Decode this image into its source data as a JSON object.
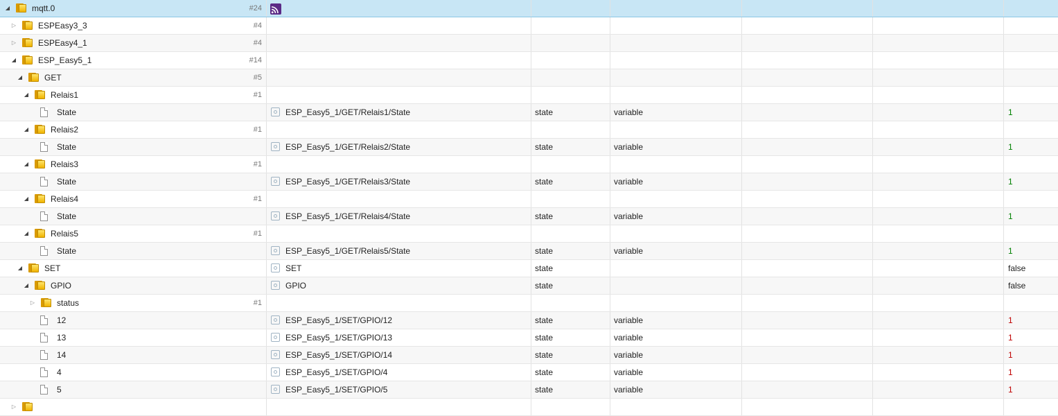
{
  "rows": [
    {
      "kind": "folder",
      "level": 0,
      "toggle": "expanded",
      "name": "mqtt.0",
      "count": "#24",
      "id": "",
      "type": "",
      "role": "",
      "value": "",
      "selected": true,
      "logo": "mqtt-adapter-icon"
    },
    {
      "kind": "folder",
      "level": 1,
      "toggle": "collapsed",
      "name": "ESPEasy3_3",
      "count": "#4",
      "id": "",
      "type": "",
      "role": "",
      "value": ""
    },
    {
      "kind": "folder",
      "level": 1,
      "toggle": "collapsed",
      "name": "ESPEasy4_1",
      "count": "#4",
      "id": "",
      "type": "",
      "role": "",
      "value": ""
    },
    {
      "kind": "folder",
      "level": 1,
      "toggle": "expanded",
      "name": "ESP_Easy5_1",
      "count": "#14",
      "id": "",
      "type": "",
      "role": "",
      "value": ""
    },
    {
      "kind": "folder",
      "level": 2,
      "toggle": "expanded",
      "name": "GET",
      "count": "#5",
      "id": "",
      "type": "",
      "role": "",
      "value": ""
    },
    {
      "kind": "folder",
      "level": 3,
      "toggle": "expanded",
      "name": "Relais1",
      "count": "#1",
      "id": "",
      "type": "",
      "role": "",
      "value": ""
    },
    {
      "kind": "file",
      "level": 4,
      "name": "State",
      "count": "",
      "id": "ESP_Easy5_1/GET/Relais1/State",
      "type": "state",
      "role": "variable",
      "value": "1",
      "valueStyle": "ok"
    },
    {
      "kind": "folder",
      "level": 3,
      "toggle": "expanded",
      "name": "Relais2",
      "count": "#1",
      "id": "",
      "type": "",
      "role": "",
      "value": ""
    },
    {
      "kind": "file",
      "level": 4,
      "name": "State",
      "count": "",
      "id": "ESP_Easy5_1/GET/Relais2/State",
      "type": "state",
      "role": "variable",
      "value": "1",
      "valueStyle": "ok"
    },
    {
      "kind": "folder",
      "level": 3,
      "toggle": "expanded",
      "name": "Relais3",
      "count": "#1",
      "id": "",
      "type": "",
      "role": "",
      "value": ""
    },
    {
      "kind": "file",
      "level": 4,
      "name": "State",
      "count": "",
      "id": "ESP_Easy5_1/GET/Relais3/State",
      "type": "state",
      "role": "variable",
      "value": "1",
      "valueStyle": "ok"
    },
    {
      "kind": "folder",
      "level": 3,
      "toggle": "expanded",
      "name": "Relais4",
      "count": "#1",
      "id": "",
      "type": "",
      "role": "",
      "value": ""
    },
    {
      "kind": "file",
      "level": 4,
      "name": "State",
      "count": "",
      "id": "ESP_Easy5_1/GET/Relais4/State",
      "type": "state",
      "role": "variable",
      "value": "1",
      "valueStyle": "ok"
    },
    {
      "kind": "folder",
      "level": 3,
      "toggle": "expanded",
      "name": "Relais5",
      "count": "#1",
      "id": "",
      "type": "",
      "role": "",
      "value": ""
    },
    {
      "kind": "file",
      "level": 4,
      "name": "State",
      "count": "",
      "id": "ESP_Easy5_1/GET/Relais5/State",
      "type": "state",
      "role": "variable",
      "value": "1",
      "valueStyle": "ok"
    },
    {
      "kind": "folder",
      "level": 2,
      "toggle": "expanded",
      "name": "SET",
      "count": "",
      "id": "SET",
      "type": "state",
      "role": "",
      "value": "false",
      "valueStyle": "plain"
    },
    {
      "kind": "folder",
      "level": 3,
      "toggle": "expanded",
      "name": "GPIO",
      "count": "",
      "id": "GPIO",
      "type": "state",
      "role": "",
      "value": "false",
      "valueStyle": "plain"
    },
    {
      "kind": "folder",
      "level": 4,
      "toggle": "collapsed",
      "name": "status",
      "count": "#1",
      "id": "",
      "type": "",
      "role": "",
      "value": ""
    },
    {
      "kind": "file",
      "level": 4,
      "name": "12",
      "count": "",
      "id": "ESP_Easy5_1/SET/GPIO/12",
      "type": "state",
      "role": "variable",
      "value": "1",
      "valueStyle": "ack"
    },
    {
      "kind": "file",
      "level": 4,
      "name": "13",
      "count": "",
      "id": "ESP_Easy5_1/SET/GPIO/13",
      "type": "state",
      "role": "variable",
      "value": "1",
      "valueStyle": "ack"
    },
    {
      "kind": "file",
      "level": 4,
      "name": "14",
      "count": "",
      "id": "ESP_Easy5_1/SET/GPIO/14",
      "type": "state",
      "role": "variable",
      "value": "1",
      "valueStyle": "ack"
    },
    {
      "kind": "file",
      "level": 4,
      "name": "4",
      "count": "",
      "id": "ESP_Easy5_1/SET/GPIO/4",
      "type": "state",
      "role": "variable",
      "value": "1",
      "valueStyle": "ack"
    },
    {
      "kind": "file",
      "level": 4,
      "name": "5",
      "count": "",
      "id": "ESP_Easy5_1/SET/GPIO/5",
      "type": "state",
      "role": "variable",
      "value": "1",
      "valueStyle": "ack"
    },
    {
      "kind": "folder",
      "level": 1,
      "toggle": "collapsed",
      "name": "",
      "count": "",
      "id": "",
      "type": "",
      "role": "",
      "value": ""
    }
  ],
  "colors": {
    "selected_row": "#c8e6f5",
    "value_ok": "#008000",
    "value_ack": "#c00000"
  }
}
